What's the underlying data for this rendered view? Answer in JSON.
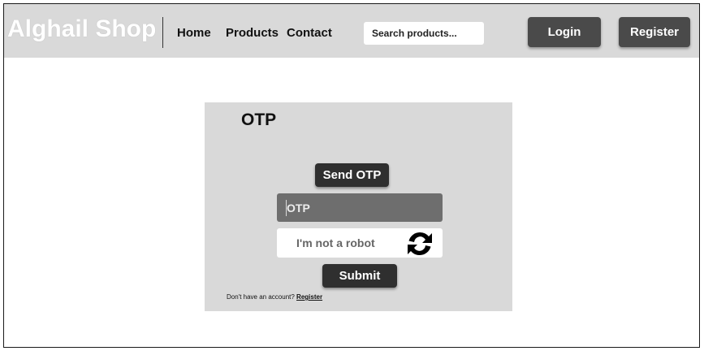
{
  "header": {
    "brand": "Alghail Shop",
    "nav": {
      "home": "Home",
      "products": "Products",
      "contact": "Contact"
    },
    "search": {
      "placeholder": "Search products..."
    },
    "login_label": "Login",
    "register_label": "Register"
  },
  "otp_form": {
    "title": "OTP",
    "send_otp_label": "Send OTP",
    "otp_placeholder": "OTP",
    "captcha_label": "I'm not a robot",
    "captcha_icon": "refresh-icon",
    "submit_label": "Submit",
    "footer_prompt": "Don't have an account?",
    "footer_link": "Register"
  },
  "colors": {
    "navbar_bg": "#d9d9d9",
    "card_bg": "#d9d9d9",
    "button_dark": "#2f2f2f",
    "header_button": "#4a4a4a",
    "otp_field_bg": "#6e6e6e"
  }
}
